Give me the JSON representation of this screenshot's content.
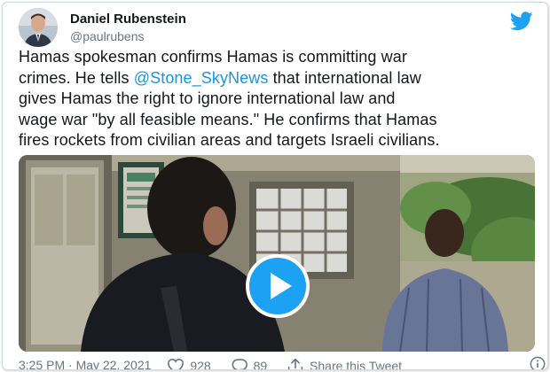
{
  "author": {
    "display_name": "Daniel Rubenstein",
    "handle": "@paulrubens"
  },
  "tweet": {
    "line1": "Hamas spokesman confirms Hamas is committing war",
    "line2_pre": "crimes. He tells ",
    "mention": "@Stone_SkyNews",
    "line2_post": " that international law",
    "line3": "gives Hamas the right to ignore international law and",
    "line4": "wage war \"by all feasible means.\" He confirms that Hamas",
    "line5": "fires rockets from civilian areas and targets Israeli civilians."
  },
  "footer": {
    "timestamp": "3:25 PM · May 22, 2021",
    "likes": "928",
    "replies": "89",
    "share_label": "Share this Tweet"
  },
  "colors": {
    "twitter_blue": "#1da1f2",
    "mention_blue": "#1b95e0",
    "like_red": "#e0245e",
    "muted": "#657786"
  },
  "icons": [
    "twitter-bird-icon",
    "play-icon",
    "heart-icon",
    "reply-icon",
    "share-icon",
    "info-icon"
  ]
}
